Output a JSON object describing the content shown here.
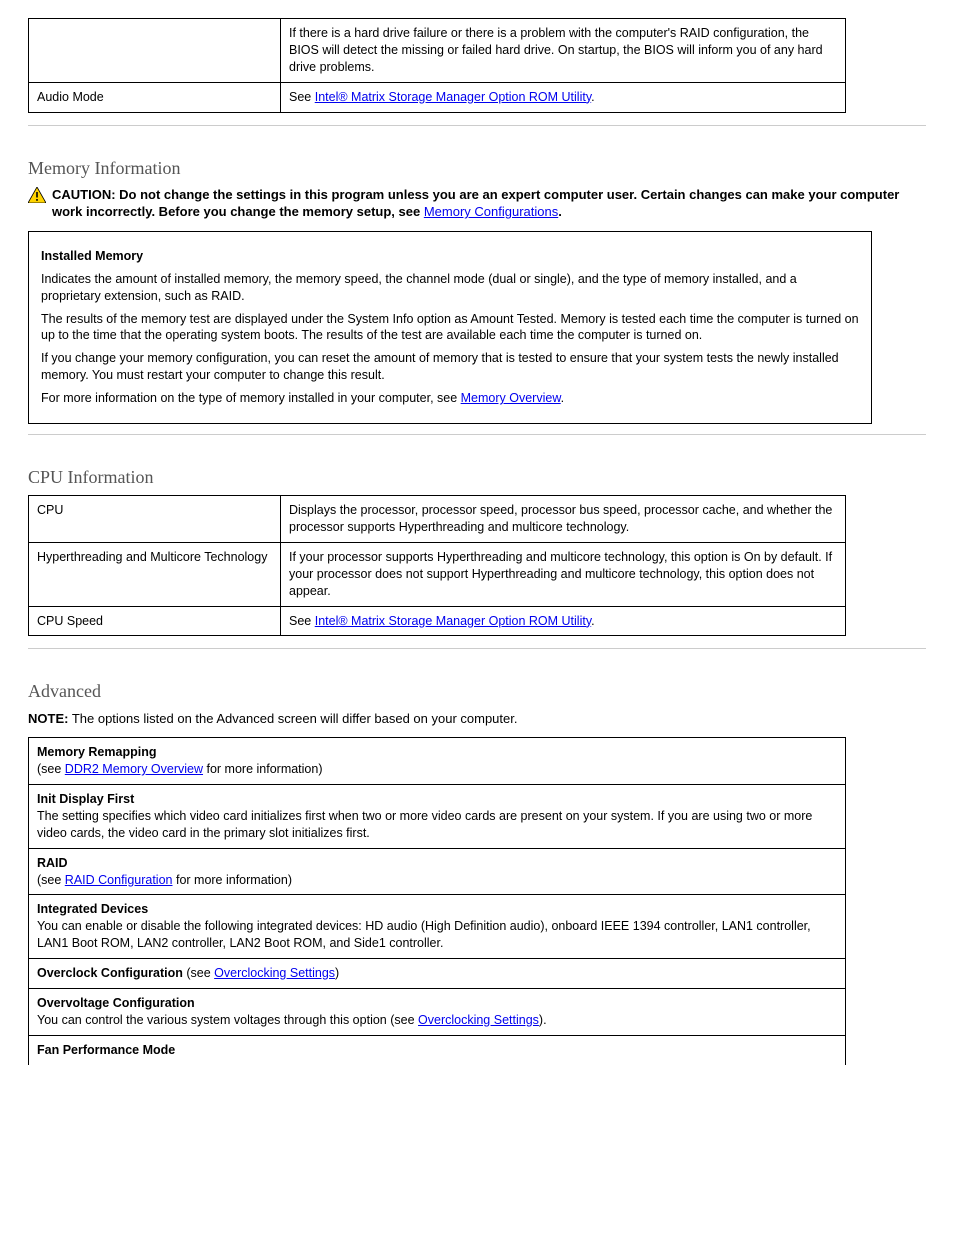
{
  "section1": {
    "row1": {
      "col1": "",
      "col2": "If there is a hard drive failure or there is a problem with the computer's RAID configuration, the BIOS will detect the missing or failed hard drive. On startup, the BIOS will inform you of any hard drive problems."
    },
    "row2": {
      "col1": "Audio Mode",
      "col2_prefix": "See ",
      "col2_link": "Intel® Matrix Storage Manager Option ROM Utility",
      "col2_suffix": "."
    }
  },
  "section2": {
    "title": "Memory Information",
    "caution_prefix": "CAUTION: Do not change the settings in this program unless you are an expert computer user. Certain changes can make your computer work incorrectly. Before you change the memory setup, see ",
    "caution_link": "Memory Configurations",
    "caution_suffix": ".",
    "box_header": "Installed Memory",
    "box_rows": [
      "Indicates the amount of installed memory, the memory speed, the channel mode (dual or single), and the type of memory installed, and a proprietary extension, such as RAID.",
      "The results of the memory test are displayed under the System Info option as Amount Tested. Memory is tested each time the computer is turned on up to the time that the operating system boots. The results of the test are available each time the computer is turned on.",
      "If you change your memory configuration, you can reset the amount of memory that is tested to ensure that your system tests the newly installed memory. You must restart your computer to change this result.",
      {
        "prefix": "For more information on the type of memory installed in your computer, see ",
        "link": "Memory Overview",
        "suffix": "."
      }
    ]
  },
  "section3": {
    "title": "CPU Information",
    "rows": [
      {
        "col1": "CPU",
        "col2": "Displays the processor, processor speed, processor bus speed, processor cache, and whether the processor supports Hyperthreading and multicore technology."
      },
      {
        "col1": "Hyperthreading and Multicore Technology",
        "col2": "If your processor supports Hyperthreading and multicore technology, this option is On by default. If your processor does not support Hyperthreading and multicore technology, this option does not appear."
      },
      {
        "col1": "CPU Speed",
        "col2_prefix": "See ",
        "col2_link": "Intel® Matrix Storage Manager Option ROM Utility",
        "col2_suffix": "."
      }
    ]
  },
  "section4": {
    "title": "Advanced",
    "note_prefix": "NOTE:",
    "note_body": " The options listed on the Advanced screen will differ based on your computer.",
    "rows": [
      {
        "col1_text": "Memory Remapping",
        "col1_prefix": "(see ",
        "col1_link": "DDR2 Memory Overview",
        "col1_suffix": " for more information)"
      },
      {
        "col1_text": "Init Display First",
        "col2": "The setting specifies which video card initializes first when two or more video cards are present on your system. If you are using two or more video cards, the video card in the primary slot initializes first."
      },
      {
        "col1_text": "RAID",
        "col1_prefix": "(see ",
        "col1_link": "RAID Configuration",
        "col1_suffix": " for more information)"
      },
      {
        "col1_text": "Integrated Devices",
        "col2": "You can enable or disable the following integrated devices: HD audio (High Definition audio), onboard IEEE 1394 controller, LAN1 controller, LAN1 Boot ROM, LAN2 controller, LAN2 Boot ROM, and Side1 controller."
      },
      {
        "col1_text": "Overclock Configuration",
        "col1_prefix": "(see ",
        "col1_link": "Overclocking Settings",
        "col1_suffix": ")"
      },
      {
        "col1_text": "Overvoltage Configuration",
        "col2_prefix": "You can control the various system voltages through this option (see ",
        "col2_link": "Overclocking Settings",
        "col2_suffix": ")."
      },
      {
        "col1_text": "Fan Performance Mode"
      }
    ]
  }
}
